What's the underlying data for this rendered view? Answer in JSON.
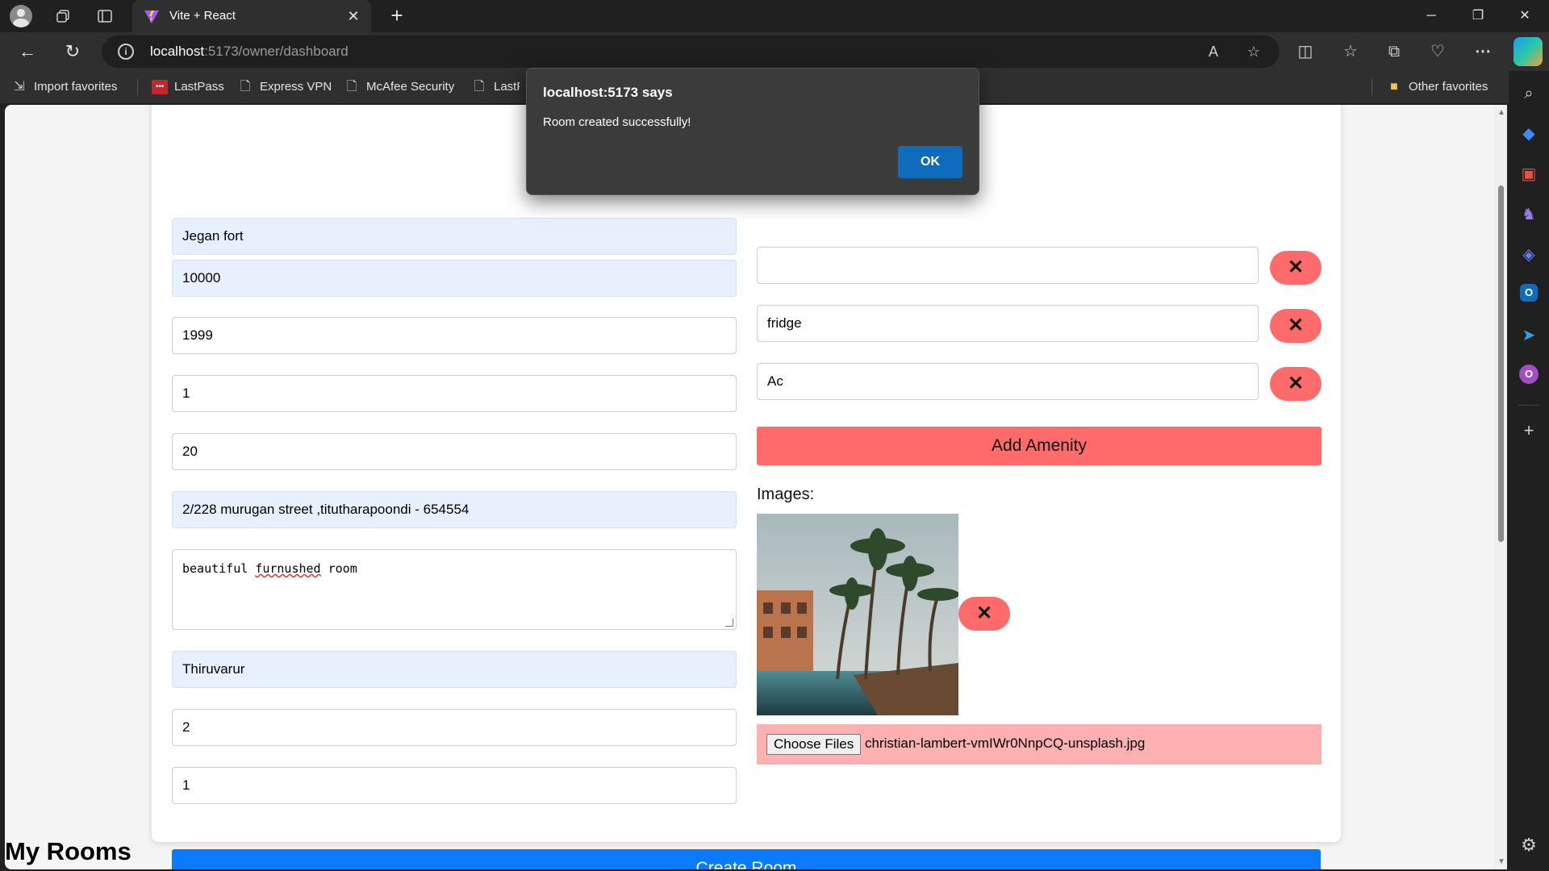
{
  "browser": {
    "tab": {
      "title": "Vite + React",
      "close": "✕"
    },
    "newtab": "+",
    "url": {
      "host": "localhost",
      "rest": ":5173/owner/dashboard"
    },
    "favorites": [
      {
        "label": "Import favorites"
      },
      {
        "label": "LastPass"
      },
      {
        "label": "Express VPN"
      },
      {
        "label": "McAfee Security"
      },
      {
        "label": "LastPa"
      }
    ],
    "other_favorites": "Other favorites"
  },
  "form": {
    "left_fields": [
      {
        "value": "Jegan fort"
      },
      {
        "value": "10000"
      },
      {
        "value": "1999"
      },
      {
        "value": "1"
      },
      {
        "value": "20"
      },
      {
        "value": "2/228 murugan street ,titutharapoondi - 654554"
      }
    ],
    "description": {
      "before": "beautiful ",
      "misspelled": "furnushed",
      "after": " room"
    },
    "left_fields_2": [
      {
        "value": "Thiruvarur"
      },
      {
        "value": "2"
      },
      {
        "value": "1"
      }
    ],
    "amenities": [
      {
        "value": ""
      },
      {
        "value": "fridge"
      },
      {
        "value": "Ac"
      }
    ],
    "remove_symbol": "✕",
    "add_amenity_label": "Add Amenity",
    "images_label": "Images:",
    "choose_files_label": "Choose Files",
    "file_name": "christian-lambert-vmIWr0NnpCQ-unsplash.jpg",
    "create_room_label": "Create Room"
  },
  "my_rooms_heading": "My Rooms",
  "dialog": {
    "title": "localhost:5173 says",
    "message": "Room created successfully!",
    "ok_label": "OK"
  },
  "colors": {
    "primary_button": "#0a7bff",
    "danger_button": "#ff6b6b",
    "file_row": "#ffb0b0",
    "dialog_ok": "#0f6cbd"
  }
}
